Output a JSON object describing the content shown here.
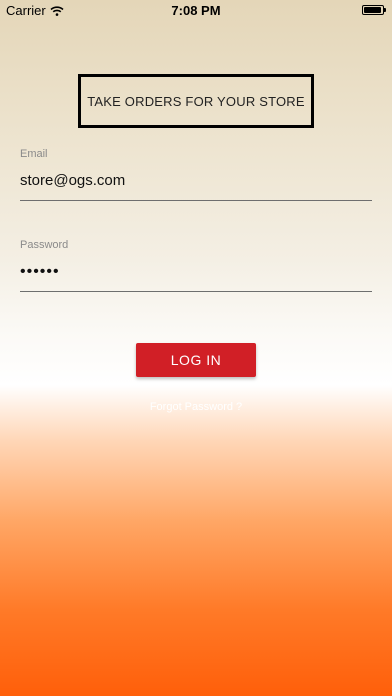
{
  "status_bar": {
    "carrier": "Carrier",
    "time": "7:08 PM"
  },
  "header": {
    "title": "TAKE ORDERS FOR YOUR STORE"
  },
  "form": {
    "email_label": "Email",
    "email_value": "store@ogs.com",
    "password_label": "Password",
    "password_value": "••••••"
  },
  "actions": {
    "login_label": "LOG IN",
    "forgot_label": "Forgot Password ?"
  },
  "colors": {
    "accent": "#d11f26",
    "gradient_bottom": "#ff5f0a",
    "gradient_top": "#e4d6b8"
  },
  "icons": [
    "wifi-icon",
    "battery-icon"
  ]
}
